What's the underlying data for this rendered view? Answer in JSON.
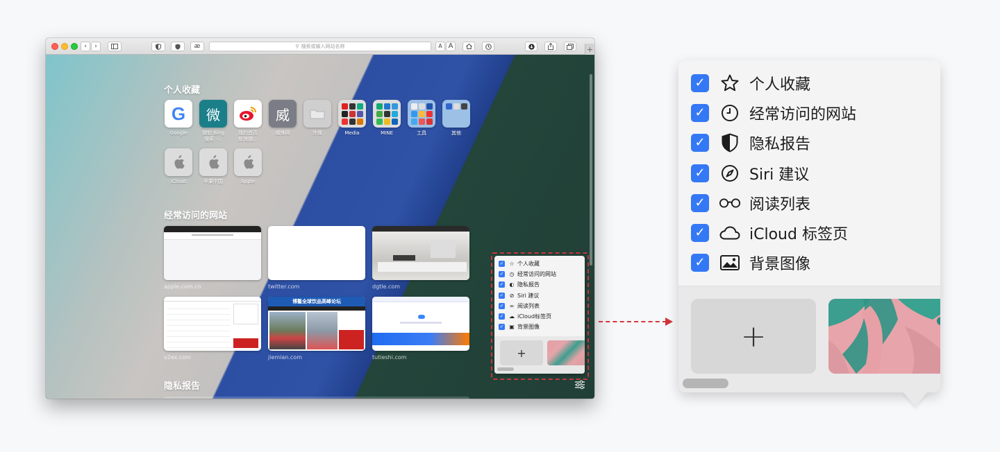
{
  "toolbar": {
    "address_placeholder": "搜索或输入网站名称",
    "ae_label": "æ",
    "text_small": "A",
    "text_large": "A",
    "new_tab": "+"
  },
  "sections": {
    "favorites": "个人收藏",
    "frequent": "经常访问的网站",
    "privacy": "隐私报告"
  },
  "favorites": [
    {
      "label": "Google",
      "glyph": "G",
      "color": "#ffffff"
    },
    {
      "label": "微软 Bing\n搜索 -...",
      "glyph": "微",
      "color": "#1b7f8a"
    },
    {
      "label": "我的首页\n新浪微...",
      "glyph": "",
      "color": "#ffffff"
    },
    {
      "label": "威锋网",
      "glyph": "威",
      "color": "#7b7d86"
    },
    {
      "label": "外媒",
      "glyph": "",
      "color": "#c9c9c9"
    },
    {
      "label": "Media",
      "glyph": "",
      "color": "#d9d9d9"
    },
    {
      "label": "MINE",
      "glyph": "",
      "color": "#d9d9d9"
    },
    {
      "label": "工具",
      "glyph": "",
      "color": "#8fb6e0"
    },
    {
      "label": "其他",
      "glyph": "",
      "color": "#8fb6e0"
    },
    {
      "label": "iCloud",
      "glyph": "",
      "color": "#d9d9d9"
    },
    {
      "label": "苹果中国",
      "glyph": "",
      "color": "#d9d9d9"
    },
    {
      "label": "Apple",
      "glyph": "",
      "color": "#d9d9d9"
    }
  ],
  "frequent_sites": [
    {
      "url": "apple.com.cn"
    },
    {
      "url": "twitter.com"
    },
    {
      "url": "dgtle.com"
    },
    {
      "url": "v2ex.com"
    },
    {
      "url": "jiemian.com",
      "banner": "博鳌全球饮品高峰论坛"
    },
    {
      "url": "tutieshi.com"
    }
  ],
  "customize_options": [
    {
      "label": "个人收藏",
      "icon": "star-icon",
      "checked": true
    },
    {
      "label": "经常访问的网站",
      "icon": "clock-icon",
      "checked": true
    },
    {
      "label": "隐私报告",
      "icon": "shield-icon",
      "checked": true
    },
    {
      "label": "Siri 建议",
      "icon": "compass-icon",
      "checked": true
    },
    {
      "label": "阅读列表",
      "icon": "glasses-icon",
      "checked": true
    },
    {
      "label": "iCloud 标签页",
      "icon": "cloud-icon",
      "checked": true
    },
    {
      "label": "背景图像",
      "icon": "image-icon",
      "checked": true
    }
  ],
  "customize_mini_labels": [
    "个人收藏",
    "经常访问的网站",
    "隐私报告",
    "Siri 建议",
    "阅读列表",
    "iCloud标签页",
    "背景图像"
  ],
  "add_background_label": "+",
  "checkmark": "✓",
  "colors": {
    "accent": "#3478f6",
    "highlight_dashed": "#c8363b"
  }
}
